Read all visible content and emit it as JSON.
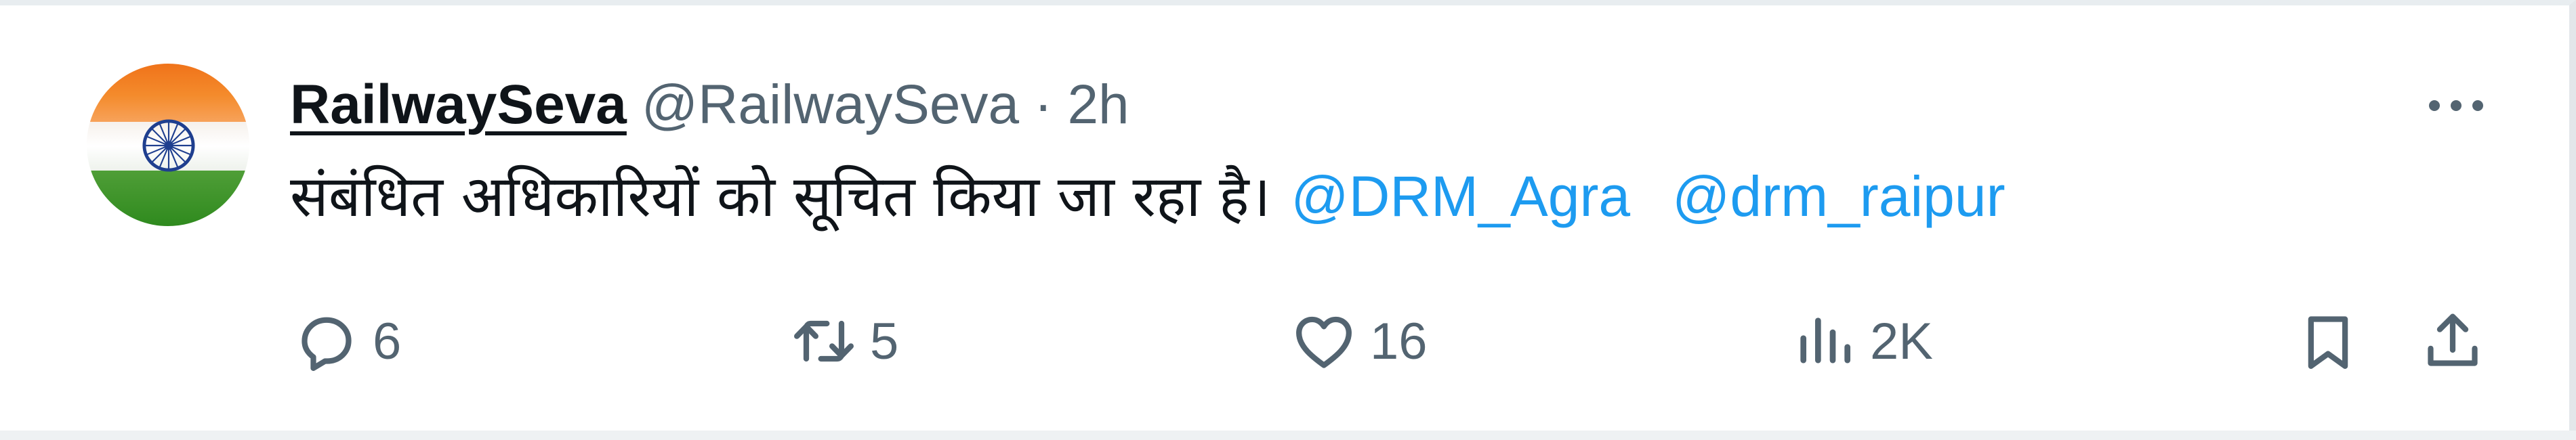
{
  "tweet": {
    "display_name": "RailwaySeva",
    "handle": "@RailwaySeva",
    "separator": "·",
    "time": "2h",
    "text": "संबंधित अधिकारियों को सूचित किया जा रहा है।",
    "mentions": [
      "@DRM_Agra",
      "@drm_raipur"
    ]
  },
  "actions": {
    "reply": {
      "icon": "reply-icon",
      "count": "6"
    },
    "retweet": {
      "icon": "retweet-icon",
      "count": "5"
    },
    "like": {
      "icon": "heart-icon",
      "count": "16"
    },
    "views": {
      "icon": "views-chart-icon",
      "count": "2K"
    },
    "bookmark": {
      "icon": "bookmark-icon"
    },
    "share": {
      "icon": "share-icon"
    }
  },
  "more": {
    "icon": "more-horizontal-icon"
  },
  "colors": {
    "text": "#0f1419",
    "secondary": "#536471",
    "link": "#1d9bf0",
    "flag_saffron": "#f0731a",
    "flag_green": "#2f8a1e",
    "chakra": "#1f3f8f"
  }
}
